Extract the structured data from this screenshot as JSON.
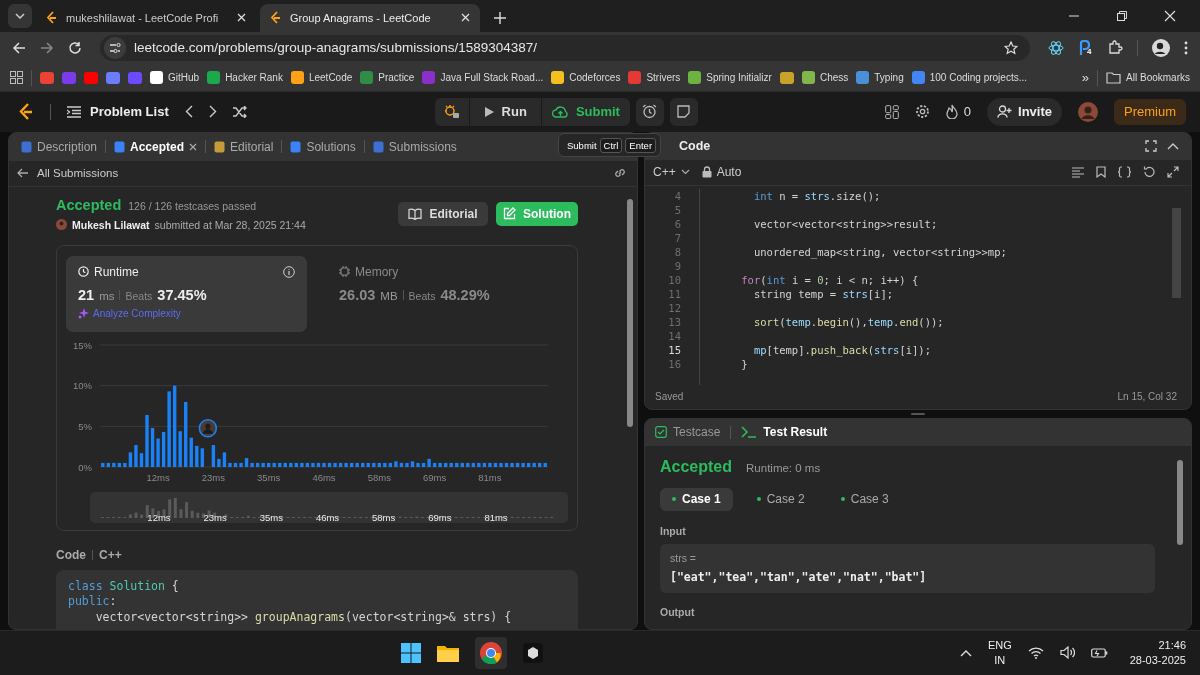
{
  "browser": {
    "tabs": [
      {
        "title": "mukeshlilawat - LeetCode Profi",
        "selected": false
      },
      {
        "title": "Group Anagrams - LeetCode",
        "selected": true
      }
    ],
    "url": "leetcode.com/problems/group-anagrams/submissions/1589304387/",
    "extension_badge": "4",
    "bookmarks": [
      {
        "kind": "icon",
        "color": "#ea4335"
      },
      {
        "kind": "icon",
        "color": "#7c3aed"
      },
      {
        "kind": "icon",
        "color": "#ff0000"
      },
      {
        "kind": "icon",
        "color": "#6b7cff"
      },
      {
        "kind": "icon",
        "color": "#6d4aff"
      },
      {
        "kind": "link",
        "label": "GitHub",
        "color": "#ffffff"
      },
      {
        "kind": "link",
        "label": "Hacker Rank",
        "color": "#1ba94c"
      },
      {
        "kind": "link",
        "label": "LeetCode",
        "color": "#ffa116"
      },
      {
        "kind": "link",
        "label": "Practice",
        "color": "#2f8d46"
      },
      {
        "kind": "link",
        "label": "Java Full Stack Road...",
        "color": "#8b2fc9"
      },
      {
        "kind": "link",
        "label": "Codeforces",
        "color": "#f4c01e"
      },
      {
        "kind": "link",
        "label": "Strivers",
        "color": "#e53935"
      },
      {
        "kind": "link",
        "label": "Spring Initializr",
        "color": "#6db33f"
      },
      {
        "kind": "icon",
        "color": "#c9a227"
      },
      {
        "kind": "link",
        "label": "Chess",
        "color": "#81b64c"
      },
      {
        "kind": "link",
        "label": "Typing",
        "color": "#4a90d9"
      },
      {
        "kind": "link",
        "label": "100 Coding projects...",
        "color": "#4285f4"
      }
    ],
    "more": "»",
    "all_bookmarks": "All Bookmarks"
  },
  "nav": {
    "problem_list": "Problem List",
    "run": "Run",
    "submit": "Submit",
    "streak": "0",
    "invite": "Invite",
    "premium": "Premium"
  },
  "tooltip": {
    "label": "Submit",
    "keys": [
      "Ctrl",
      "Enter"
    ]
  },
  "left_panel": {
    "tabs": [
      {
        "label": "Description",
        "selected": false,
        "closable": false,
        "color": "#3b6fd1"
      },
      {
        "label": "Accepted",
        "selected": true,
        "closable": true,
        "color": "#3b82f6"
      },
      {
        "label": "Editorial",
        "selected": false,
        "closable": false,
        "color": "#c49a3a"
      },
      {
        "label": "Solutions",
        "selected": false,
        "closable": false,
        "color": "#3b82f6"
      },
      {
        "label": "Submissions",
        "selected": false,
        "closable": false,
        "color": "#3b6fd1"
      }
    ],
    "back": "All Submissions"
  },
  "submission": {
    "status": "Accepted",
    "passed": "126 / 126 testcases passed",
    "author": "Mukesh Lilawat",
    "submitted": "submitted at Mar 28, 2025 21:44",
    "buttons": [
      {
        "label": "Editorial",
        "kind": "plain"
      },
      {
        "label": "Solution",
        "kind": "primary"
      }
    ],
    "stats": [
      {
        "title": "Runtime",
        "kind": "runtime",
        "selected": true,
        "value": "21",
        "unit": "ms",
        "beats_label": "Beats",
        "beats": "37.45%",
        "link": "Analyze Complexity"
      },
      {
        "title": "Memory",
        "kind": "memory",
        "selected": false,
        "value": "26.03",
        "unit": "MB",
        "beats_label": "Beats",
        "beats": "48.29%"
      }
    ],
    "chart": {
      "chart_data": {
        "type": "bar",
        "ylim": [
          0,
          15
        ],
        "yticks": [
          {
            "value": 0,
            "label": "0%"
          },
          {
            "value": 5,
            "label": "5%"
          },
          {
            "value": 10,
            "label": "10%"
          },
          {
            "value": 15,
            "label": "15%"
          }
        ],
        "categories": [
          null,
          null,
          null,
          null,
          null,
          null,
          null,
          null,
          null,
          null,
          "12ms",
          null,
          null,
          null,
          null,
          null,
          null,
          null,
          null,
          null,
          "23ms",
          null,
          null,
          null,
          null,
          null,
          null,
          null,
          null,
          null,
          "35ms",
          null,
          null,
          null,
          null,
          null,
          null,
          null,
          null,
          null,
          "46ms",
          null,
          null,
          null,
          null,
          null,
          null,
          null,
          null,
          null,
          "58ms",
          null,
          null,
          null,
          null,
          null,
          null,
          null,
          null,
          null,
          "69ms",
          null,
          null,
          null,
          null,
          null,
          null,
          null,
          null,
          null,
          "81ms",
          null,
          null,
          null,
          null,
          null,
          null,
          null,
          null,
          null,
          null
        ],
        "values": [
          0.5,
          0.5,
          0.5,
          0.5,
          0.5,
          1.8,
          2.7,
          1.7,
          6.4,
          4.8,
          3.5,
          4.3,
          9.3,
          10,
          4.4,
          8,
          3.6,
          2.6,
          2.3,
          null,
          2.7,
          1.0,
          1.8,
          0.5,
          0.5,
          0.5,
          1.1,
          0.5,
          0.5,
          0.5,
          0.5,
          0.5,
          0.5,
          0.5,
          0.5,
          0.5,
          0.5,
          0.5,
          0.5,
          0.5,
          0.5,
          0.5,
          0.5,
          0.5,
          0.5,
          0.5,
          0.5,
          0.5,
          0.5,
          0.5,
          0.5,
          0.5,
          0.5,
          0.7,
          0.5,
          0.5,
          0.7,
          0.5,
          0.5,
          1.0,
          0.5,
          0.5,
          0.5,
          0.5,
          0.5,
          0.5,
          0.5,
          0.5,
          0.5,
          0.5,
          0.5,
          0.5,
          0.5,
          0.5,
          0.5,
          0.5,
          0.5,
          0.5,
          0.5,
          0.5,
          0.5
        ]
      },
      "overview_labels": [
        "12ms",
        "23ms",
        "35ms",
        "46ms",
        "58ms",
        "69ms",
        "81ms"
      ]
    },
    "code_label": "Code",
    "language": "C++",
    "code": [
      {
        "tokens": [
          {
            "text": "class",
            "kind": "keyword"
          },
          {
            "text": " Solution",
            "kind": "type"
          },
          {
            "text": " {",
            "kind": "plain"
          }
        ]
      },
      {
        "tokens": [
          {
            "text": "public",
            "kind": "keyword"
          },
          {
            "text": ":",
            "kind": "plain"
          }
        ]
      },
      {
        "tokens": [
          {
            "text": "    vector<vector<string>> ",
            "kind": "plain"
          },
          {
            "text": "groupAnagrams",
            "kind": "function"
          },
          {
            "text": "(vector<string>& strs) {",
            "kind": "plain"
          }
        ]
      }
    ]
  },
  "editor": {
    "title": "Code",
    "language": "C++",
    "mode": "Auto",
    "status": "Saved",
    "position": "Ln 15, Col 32",
    "lines": [
      {
        "number": "4",
        "current": false,
        "tokens": [
          {
            "text": "      int",
            "kind": "keyword"
          },
          {
            "text": " n = ",
            "kind": "plain"
          },
          {
            "text": "strs",
            "kind": "variable"
          },
          {
            "text": ".size();",
            "kind": "plain"
          }
        ]
      },
      {
        "number": "5",
        "current": false
      },
      {
        "number": "6",
        "current": false,
        "tokens": [
          {
            "text": "      vector<vector<string>>result;",
            "kind": "plain"
          }
        ]
      },
      {
        "number": "7",
        "current": false
      },
      {
        "number": "8",
        "current": false,
        "tokens": [
          {
            "text": "      unordered_map<string, vector<string>>mp;",
            "kind": "plain"
          }
        ]
      },
      {
        "number": "9",
        "current": false
      },
      {
        "number": "10",
        "current": false,
        "tokens": [
          {
            "text": "    for",
            "kind": "control"
          },
          {
            "text": "(",
            "kind": "plain"
          },
          {
            "text": "int",
            "kind": "keyword"
          },
          {
            "text": " i = ",
            "kind": "plain"
          },
          {
            "text": "0",
            "kind": "number"
          },
          {
            "text": "; i < n; i++) {",
            "kind": "plain"
          }
        ]
      },
      {
        "number": "11",
        "current": false,
        "tokens": [
          {
            "text": "      string temp = ",
            "kind": "plain"
          },
          {
            "text": "strs",
            "kind": "variable"
          },
          {
            "text": "[i];",
            "kind": "plain"
          }
        ]
      },
      {
        "number": "12",
        "current": false
      },
      {
        "number": "13",
        "current": false,
        "tokens": [
          {
            "text": "      sort",
            "kind": "function"
          },
          {
            "text": "(",
            "kind": "plain"
          },
          {
            "text": "temp",
            "kind": "variable"
          },
          {
            "text": ".",
            "kind": "plain"
          },
          {
            "text": "begin",
            "kind": "function"
          },
          {
            "text": "(),",
            "kind": "plain"
          },
          {
            "text": "temp",
            "kind": "variable"
          },
          {
            "text": ".",
            "kind": "plain"
          },
          {
            "text": "end",
            "kind": "function"
          },
          {
            "text": "());",
            "kind": "plain"
          }
        ]
      },
      {
        "number": "14",
        "current": false
      },
      {
        "number": "15",
        "current": true,
        "tokens": [
          {
            "text": "      mp",
            "kind": "variable"
          },
          {
            "text": "[temp].",
            "kind": "plain"
          },
          {
            "text": "push_back",
            "kind": "function"
          },
          {
            "text": "(",
            "kind": "plain"
          },
          {
            "text": "strs",
            "kind": "variable"
          },
          {
            "text": "[i]);",
            "kind": "plain"
          }
        ]
      },
      {
        "number": "16",
        "current": false,
        "tokens": [
          {
            "text": "    }",
            "kind": "plain"
          }
        ]
      }
    ]
  },
  "result_panel": {
    "tabs": [
      {
        "label": "Testcase",
        "selected": false
      },
      {
        "label": "Test Result",
        "selected": true
      }
    ],
    "status": "Accepted",
    "runtime": "Runtime: 0 ms",
    "cases": [
      {
        "label": "Case 1",
        "selected": true
      },
      {
        "label": "Case 2",
        "selected": false
      },
      {
        "label": "Case 3",
        "selected": false
      }
    ],
    "input_label": "Input",
    "input_name": "strs =",
    "input_value": "[\"eat\",\"tea\",\"tan\",\"ate\",\"nat\",\"bat\"]",
    "output_label": "Output"
  },
  "taskbar": {
    "language": "ENG",
    "region": "IN",
    "time": "21:46",
    "date": "28-03-2025"
  }
}
